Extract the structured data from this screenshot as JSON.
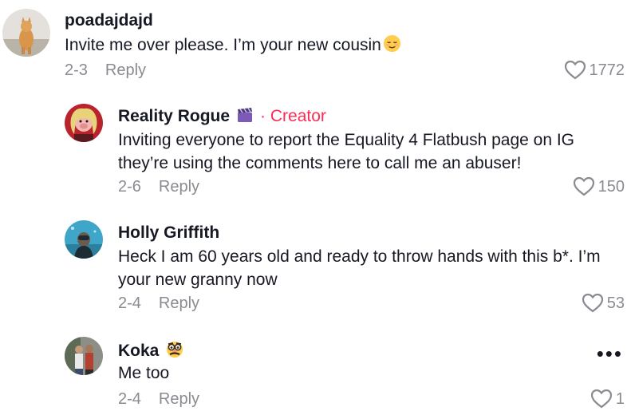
{
  "comments": [
    {
      "username": "poadajdajd",
      "text_lines": [
        "Invite me over please. I’m your new cousin"
      ],
      "date": "2-3",
      "reply_label": "Reply",
      "likes": "1772",
      "avatar_icon": "cat-costume-avatar",
      "emoji": "relieved-face-emoji"
    },
    {
      "username": "Reality Rogue",
      "creator_label": "· Creator",
      "text_lines": [
        "Inviting everyone to report the Equality 4 Flatbush page on IG",
        "they’re using the comments here to call me an abuser!"
      ],
      "date": "2-6",
      "reply_label": "Reply",
      "likes": "150",
      "avatar_icon": "miss-piggy-avatar",
      "badge_icon": "clapper-board-icon"
    },
    {
      "username": "Holly Griffith",
      "text_lines": [
        "Heck I am 60 years old and ready to throw hands with this b*. I’m",
        "your new granny now"
      ],
      "date": "2-4",
      "reply_label": "Reply",
      "likes": "53",
      "avatar_icon": "underwater-diver-avatar"
    },
    {
      "username": "Koka",
      "text_lines": [
        "Me too"
      ],
      "date": "2-4",
      "reply_label": "Reply",
      "likes": "1",
      "avatar_icon": "two-people-avatar",
      "badge_icon": "disguise-face-emoji",
      "more_label": "•••"
    }
  ],
  "colors": {
    "creator": "#fe2c55",
    "meta": "#8a8b91",
    "text": "#161823"
  }
}
